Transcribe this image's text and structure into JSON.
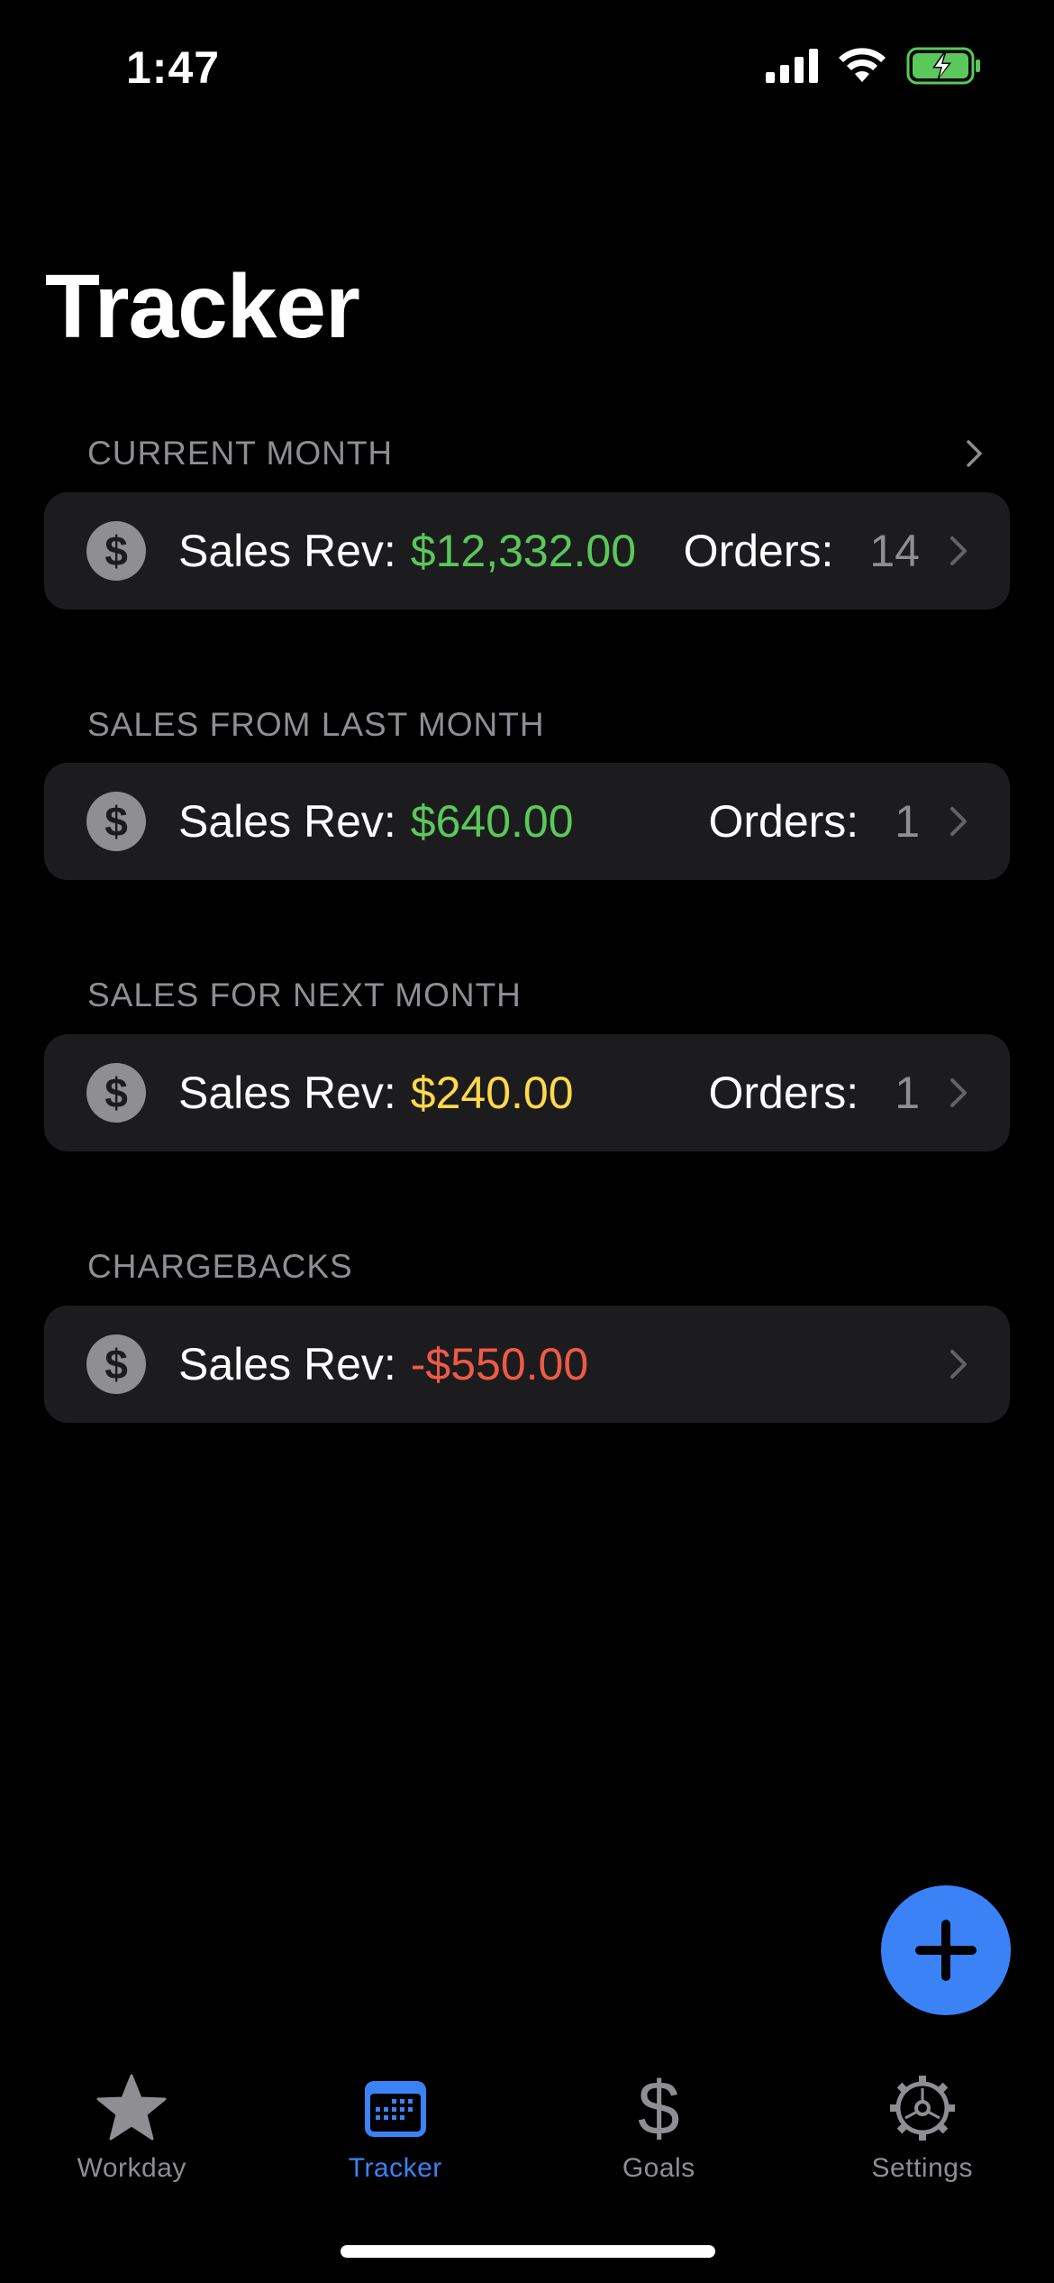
{
  "status_bar": {
    "time": "1:47"
  },
  "title": "Tracker",
  "sections": [
    {
      "header": "CURRENT MONTH",
      "rev_label": "Sales Rev:",
      "rev_value": "$12,332.00",
      "rev_color": "#5ac85a",
      "orders_label": "Orders:",
      "orders_count": "14"
    },
    {
      "header": "SALES FROM LAST MONTH",
      "rev_label": "Sales Rev:",
      "rev_value": "$640.00",
      "rev_color": "#5ac85a",
      "orders_label": "Orders:",
      "orders_count": "1"
    },
    {
      "header": "SALES FOR NEXT MONTH",
      "rev_label": "Sales Rev:",
      "rev_value": "$240.00",
      "rev_color": "#ffd94a",
      "orders_label": "Orders:",
      "orders_count": "1"
    },
    {
      "header": "CHARGEBACKS",
      "rev_label": "Sales Rev:",
      "rev_value": "-$550.00",
      "rev_color": "#ef5a46"
    }
  ],
  "tabs": [
    {
      "label": "Workday",
      "icon": "star-icon",
      "active": false
    },
    {
      "label": "Tracker",
      "icon": "calendar-icon",
      "active": true
    },
    {
      "label": "Goals",
      "icon": "dollar-icon",
      "active": false
    },
    {
      "label": "Settings",
      "icon": "gear-icon",
      "active": false
    }
  ],
  "colors": {
    "accent": "#3b82f6",
    "card_bg": "#1c1c1e",
    "secondary_text": "#8e8e93"
  }
}
